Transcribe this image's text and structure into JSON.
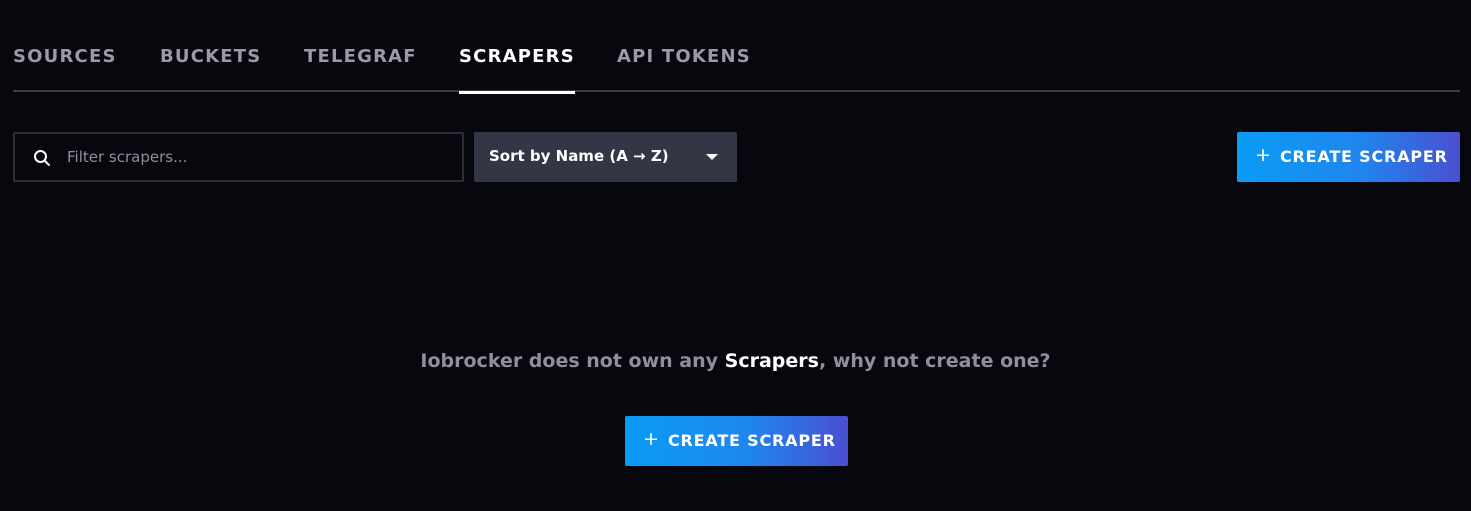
{
  "tabs": [
    {
      "label": "SOURCES",
      "active": false
    },
    {
      "label": "BUCKETS",
      "active": false
    },
    {
      "label": "TELEGRAF",
      "active": false
    },
    {
      "label": "SCRAPERS",
      "active": true
    },
    {
      "label": "API TOKENS",
      "active": false
    }
  ],
  "toolbar": {
    "search_placeholder": "Filter scrapers...",
    "search_value": "",
    "sort_label": "Sort by Name (A → Z)",
    "create_plus": "+",
    "create_label": "CREATE SCRAPER"
  },
  "empty_state": {
    "prefix": "Iobrocker does not own any ",
    "highlight": "Scrapers",
    "suffix": ", why not create one?",
    "create_plus": "+",
    "create_label": "CREATE SCRAPER"
  },
  "icons": {
    "search": "search-icon",
    "caret": "chevron-down-icon",
    "plus": "plus-icon"
  },
  "colors": {
    "background": "#07080d",
    "active_tab": "#ffffff",
    "inactive_tab": "#9a9aa8",
    "dropdown_bg": "#343545",
    "button_gradient_start": "#0a9cf5",
    "button_gradient_end": "#4a4fd0"
  }
}
